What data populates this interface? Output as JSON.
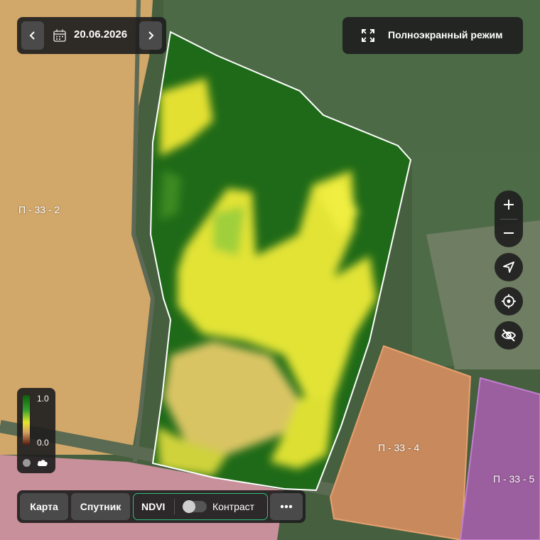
{
  "header": {
    "date": "20.06.2026",
    "fullscreen_label": "Полноэкранный режим"
  },
  "fields": {
    "left": "П - 33 - 2",
    "right_center": "П - 33 - 4",
    "right_edge": "П - 33 - 5"
  },
  "legend": {
    "max": "1.0",
    "min": "0.0"
  },
  "bottom_bar": {
    "map_label": "Карта",
    "satellite_label": "Спутник",
    "ndvi_label": "NDVI",
    "contrast_label": "Контраст",
    "contrast_on": false
  },
  "icons": {
    "prev": "chevron-left-icon",
    "next": "chevron-right-icon",
    "calendar": "calendar-icon",
    "fullscreen": "fullscreen-icon",
    "zoom_in": "plus-icon",
    "zoom_out": "minus-icon",
    "navigate": "navigation-arrow-icon",
    "locate": "target-icon",
    "hide": "eye-off-icon",
    "more": "more-icon"
  },
  "colors": {
    "accent": "#2fbf7c",
    "panel": "#202020",
    "button": "#4a4a4a"
  }
}
